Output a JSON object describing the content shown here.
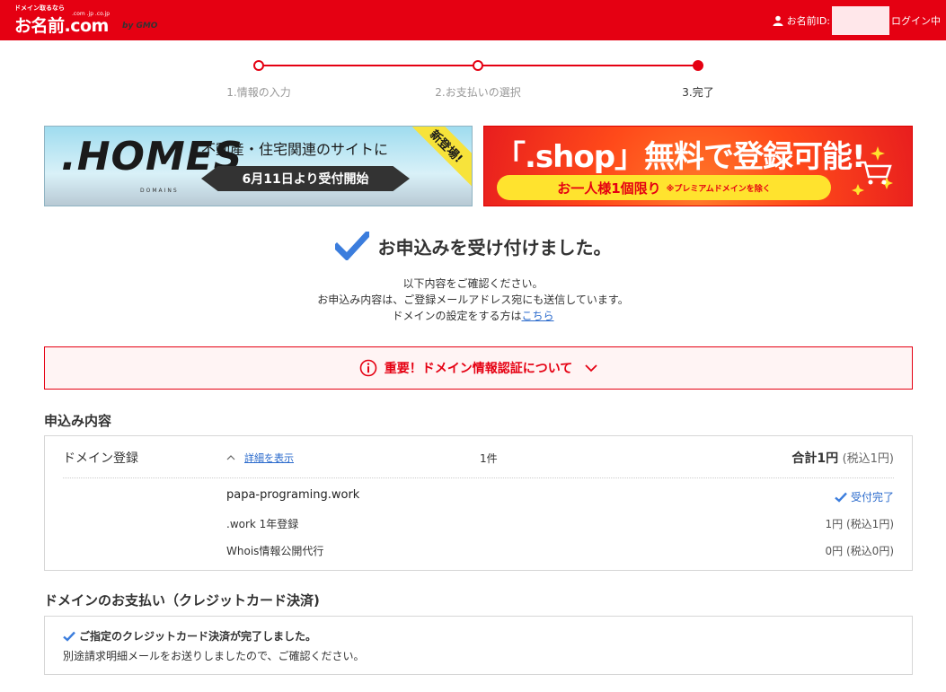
{
  "header": {
    "logo_tagline": "ドメイン取るなら",
    "logo_tlds": ".com .jp .co.jp",
    "logo_text": "お名前.com",
    "logo_gmo": "by GMO",
    "user_label": "お名前ID:",
    "user_status": "ログイン中"
  },
  "steps": [
    {
      "label": "1.情報の入力"
    },
    {
      "label": "2.お支払いの選択"
    },
    {
      "label": "3.完了"
    }
  ],
  "banners": {
    "homes": {
      "logo": ".HOMES",
      "logo_sub": "DOMAINS",
      "headline": "不動産・住宅関連のサイトに",
      "pill": "6月11日より受付開始",
      "ribbon": "新登場!"
    },
    "shop": {
      "title": "「.shop」無料で登録可能!",
      "pill_main": "お一人様1個限り",
      "pill_note": "※プレミアムドメインを除く"
    }
  },
  "complete": {
    "title": "お申込みを受け付けました。",
    "line1": "以下内容をご確認ください。",
    "line2": "お申込み内容は、ご登録メールアドレス宛にも送信しています。",
    "line3_prefix": "ドメインの設定をする方は",
    "line3_link": "こちら"
  },
  "alert": {
    "text": "重要！ドメイン情報認証について"
  },
  "order": {
    "section_title": "申込み内容",
    "label": "ドメイン登録",
    "detail_toggle": "詳細を表示",
    "count": "1件",
    "total_label": "合計1円",
    "total_tax": "(税込1円)",
    "domain": "papa-programing.work",
    "status": "受付完了",
    "items": [
      {
        "name": ".work 1年登録",
        "price": "1円 (税込1円)"
      },
      {
        "name": "Whois情報公開代行",
        "price": "0円 (税込0円)"
      }
    ]
  },
  "payment": {
    "section_title": "ドメインのお支払い（クレジットカード決済)",
    "line1": "ご指定のクレジットカード決済が完了しました。",
    "line2": "別途請求明細メールをお送りしましたので、ご確認ください。"
  },
  "colors": {
    "brand": "#e50012",
    "link": "#2a6acc",
    "check": "#3b7ddd"
  }
}
